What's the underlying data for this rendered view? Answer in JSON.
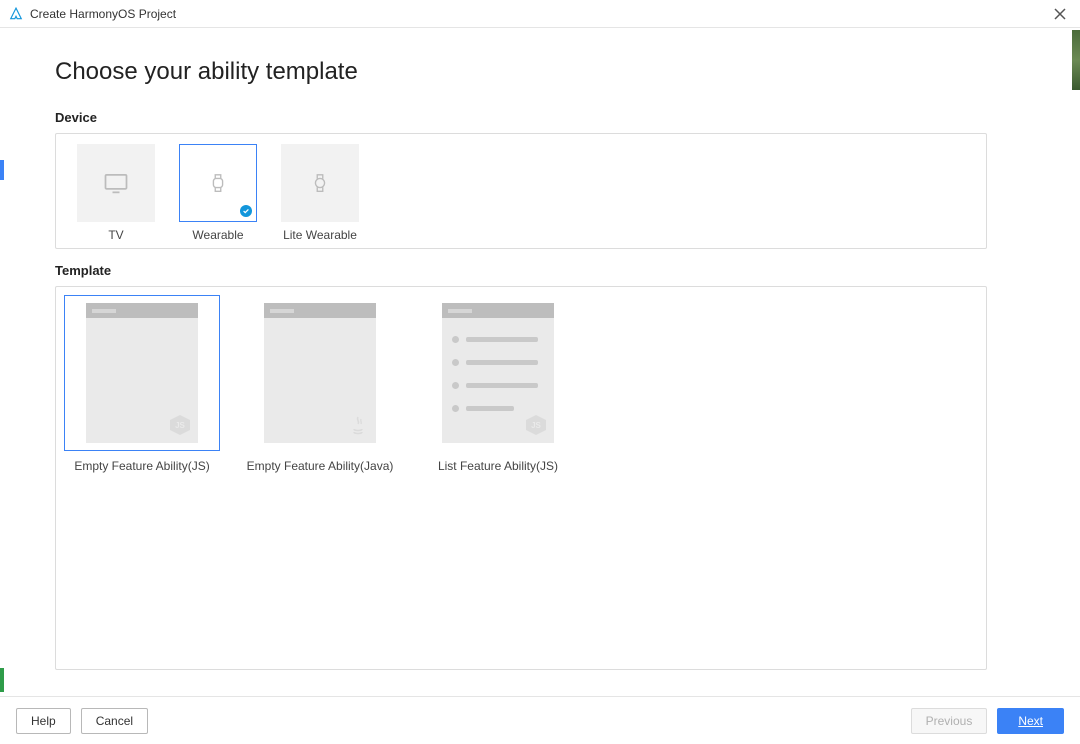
{
  "window": {
    "title": "Create HarmonyOS Project"
  },
  "heading": "Choose your ability template",
  "sections": {
    "device_label": "Device",
    "template_label": "Template"
  },
  "devices": [
    {
      "label": "TV",
      "selected": false
    },
    {
      "label": "Wearable",
      "selected": true
    },
    {
      "label": "Lite Wearable",
      "selected": false
    }
  ],
  "templates": [
    {
      "label": "Empty Feature Ability(JS)",
      "badge": "JS",
      "selected": true,
      "kind": "empty"
    },
    {
      "label": "Empty Feature Ability(Java)",
      "badge": "Java",
      "selected": false,
      "kind": "empty"
    },
    {
      "label": "List Feature Ability(JS)",
      "badge": "JS",
      "selected": false,
      "kind": "list"
    }
  ],
  "footer": {
    "help": "Help",
    "cancel": "Cancel",
    "previous": "Previous",
    "next": "Next"
  }
}
